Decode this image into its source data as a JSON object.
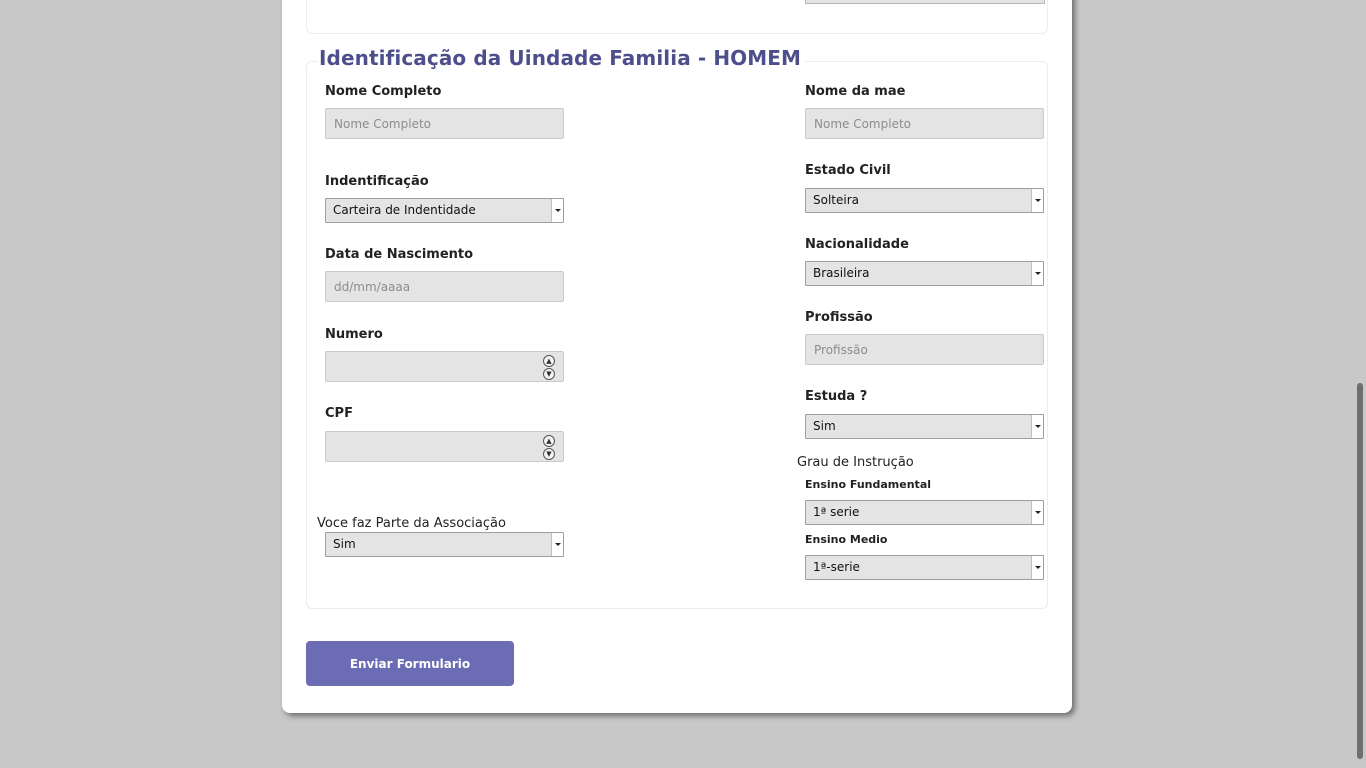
{
  "form": {
    "legend": "Identificação da Uindade Familia - HOMEM",
    "left": {
      "nome_label": "Nome Completo",
      "nome_placeholder": "Nome Completo",
      "ident_label": "Indentificação",
      "ident_value": "Carteira de Indentidade",
      "nasc_label": "Data de Nascimento",
      "nasc_placeholder": "dd/mm/aaaa",
      "numero_label": "Numero",
      "cpf_label": "CPF",
      "assoc_label": "Voce faz Parte da Associação",
      "assoc_value": "Sim"
    },
    "right": {
      "mae_label": "Nome da mae",
      "mae_placeholder": "Nome Completo",
      "civil_label": "Estado Civil",
      "civil_value": "Solteira",
      "nac_label": "Nacionalidade",
      "nac_value": "Brasileira",
      "prof_label": "Profissão",
      "prof_placeholder": "Profissão",
      "estuda_label": "Estuda ?",
      "estuda_value": "Sim",
      "grau_label": "Grau de Instrução",
      "fund_label": "Ensino Fundamental",
      "fund_value": "1ª serie",
      "medio_label": "Ensino Medio",
      "medio_value": "1ª-serie"
    }
  },
  "submit_label": "Enviar Formulario",
  "colors": {
    "accent": "#6c6cb4",
    "legend": "#4c4f8c",
    "background": "#c8c8c8"
  }
}
